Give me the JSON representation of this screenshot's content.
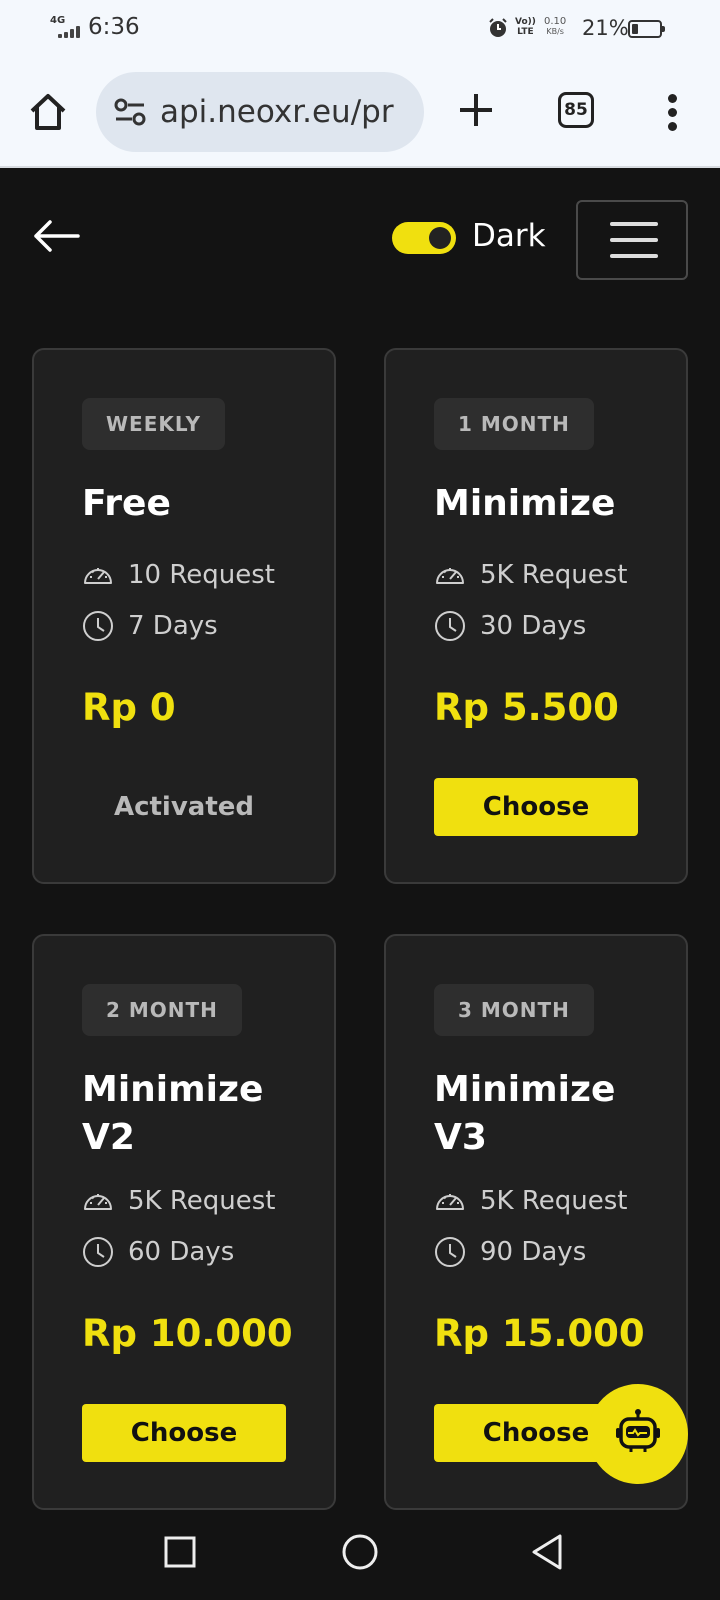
{
  "status_bar": {
    "network": "4G",
    "time": "6:36",
    "volte_top": "Vo))",
    "volte_bottom": "LTE",
    "speed_value": "0.10",
    "speed_unit": "KB/s",
    "battery_percent": "21%"
  },
  "browser": {
    "url": "api.neoxr.eu/pr",
    "tab_count": "85"
  },
  "header": {
    "theme_label": "Dark",
    "theme_on": true
  },
  "plans": [
    {
      "badge": "WEEKLY",
      "name": "Free",
      "requests": "10 Request",
      "days": "7 Days",
      "price": "Rp 0",
      "action": "Activated"
    },
    {
      "badge": "1 MONTH",
      "name": "Minimize",
      "requests": "5K Request",
      "days": "30 Days",
      "price": "Rp 5.500",
      "action": "Choose"
    },
    {
      "badge": "2 MONTH",
      "name": "Minimize V2",
      "requests": "5K Request",
      "days": "60 Days",
      "price": "Rp 10.000",
      "action": "Choose"
    },
    {
      "badge": "3 MONTH",
      "name": "Minimize V3",
      "requests": "5K Request",
      "days": "90 Days",
      "price": "Rp 15.000",
      "action": "Choose"
    }
  ],
  "colors": {
    "accent": "#f0e00f",
    "background": "#131313",
    "card": "#202020"
  }
}
